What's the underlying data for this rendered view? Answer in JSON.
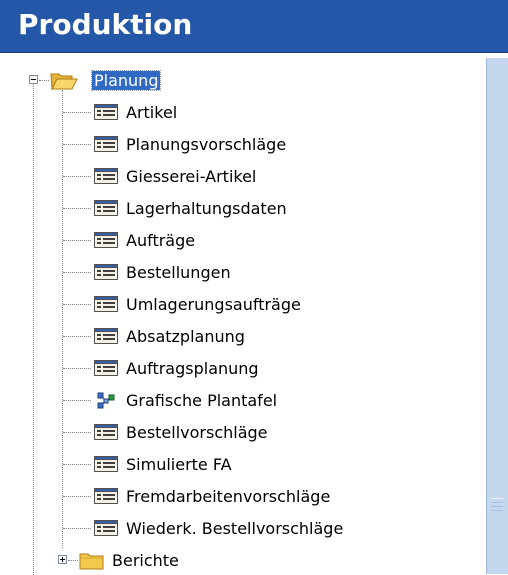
{
  "header": {
    "title": "Produktion"
  },
  "tree": {
    "root": {
      "label": "Planung",
      "expanded": true,
      "icon": "folder-open-icon"
    },
    "children": [
      {
        "label": "Artikel",
        "icon": "form-icon"
      },
      {
        "label": "Planungsvorschläge",
        "icon": "form-icon"
      },
      {
        "label": "Giesserei-Artikel",
        "icon": "form-icon"
      },
      {
        "label": "Lagerhaltungsdaten",
        "icon": "form-icon"
      },
      {
        "label": "Aufträge",
        "icon": "form-icon"
      },
      {
        "label": "Bestellungen",
        "icon": "form-icon"
      },
      {
        "label": "Umlagerungsaufträge",
        "icon": "form-icon"
      },
      {
        "label": "Absatzplanung",
        "icon": "form-icon"
      },
      {
        "label": "Auftragsplanung",
        "icon": "form-icon"
      },
      {
        "label": "Grafische Plantafel",
        "icon": "graph-icon"
      },
      {
        "label": "Bestellvorschläge",
        "icon": "form-icon"
      },
      {
        "label": "Simulierte FA",
        "icon": "form-icon"
      },
      {
        "label": "Fremdarbeitenvorschläge",
        "icon": "form-icon"
      },
      {
        "label": "Wiederk. Bestellvorschläge",
        "icon": "form-icon"
      }
    ],
    "sibling": {
      "label": "Berichte",
      "expanded": false,
      "icon": "folder-closed-icon"
    }
  },
  "colors": {
    "header_bg": "#2457a8",
    "selection_bg": "#316ac5",
    "scrollbar_bg": "#c4d7ef"
  }
}
